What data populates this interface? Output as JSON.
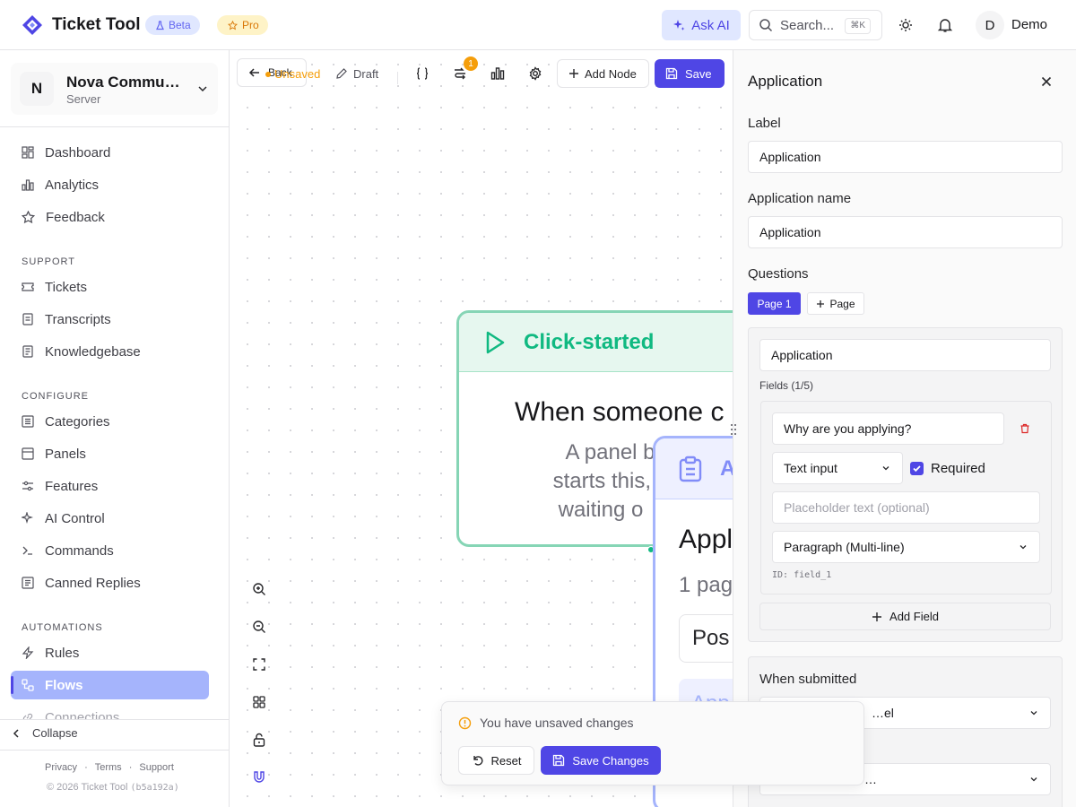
{
  "app": {
    "title": "Ticket Tool",
    "beta": "Beta",
    "pro": "Pro"
  },
  "header": {
    "ask_ai": "Ask AI",
    "search_placeholder": "Search...",
    "search_kbd": "⌘K",
    "avatar_initial": "D",
    "user": "Demo"
  },
  "server": {
    "initial": "N",
    "name": "Nova Community",
    "type": "Server"
  },
  "nav": {
    "top": [
      {
        "label": "Dashboard",
        "icon": "dashboard-icon"
      },
      {
        "label": "Analytics",
        "icon": "bar-chart-icon"
      },
      {
        "label": "Feedback",
        "icon": "star-icon"
      }
    ],
    "support_title": "SUPPORT",
    "support": [
      {
        "label": "Tickets",
        "icon": "ticket-icon"
      },
      {
        "label": "Transcripts",
        "icon": "transcript-icon"
      },
      {
        "label": "Knowledgebase",
        "icon": "book-icon"
      }
    ],
    "configure_title": "CONFIGURE",
    "configure": [
      {
        "label": "Categories",
        "icon": "list-icon"
      },
      {
        "label": "Panels",
        "icon": "panel-icon"
      },
      {
        "label": "Features",
        "icon": "sliders-icon"
      },
      {
        "label": "AI Control",
        "icon": "sparkle-icon"
      },
      {
        "label": "Commands",
        "icon": "terminal-icon"
      },
      {
        "label": "Canned Replies",
        "icon": "reply-icon"
      }
    ],
    "automations_title": "AUTOMATIONS",
    "automations": [
      {
        "label": "Rules",
        "icon": "bolt-icon"
      },
      {
        "label": "Flows",
        "icon": "flow-icon",
        "active": true
      },
      {
        "label": "Connections",
        "icon": "link-icon"
      }
    ]
  },
  "sidebar_footer": {
    "collapse": "Collapse",
    "links": [
      "Privacy",
      "Terms",
      "Support"
    ],
    "copyright": "© 2026 Ticket Tool",
    "build": "(b5a192a)"
  },
  "toolbar": {
    "back": "Back",
    "unsaved": "Unsaved",
    "draft": "Draft",
    "badge": "1",
    "add_node": "Add Node",
    "save": "Save"
  },
  "nodes": {
    "trigger": {
      "header": "Click-started",
      "title": "When someone c",
      "desc_lines": [
        "A panel buttor",
        "starts this, an",
        "waiting o"
      ]
    },
    "application": {
      "header": "A",
      "title": "Appl",
      "subtitle": "1 pag",
      "pos": "Pos",
      "app": "App"
    }
  },
  "unsaved_bar": {
    "message": "You have unsaved changes",
    "reset": "Reset",
    "save_changes": "Save Changes"
  },
  "panel": {
    "title": "Application",
    "label_title": "Label",
    "label_value": "Application",
    "name_title": "Application name",
    "name_value": "Application",
    "questions_title": "Questions",
    "page_chip": "Page 1",
    "page_add": "Page",
    "page_name": "Application",
    "fields_count": "Fields (1/5)",
    "field": {
      "question": "Why are you applying?",
      "type": "Text input",
      "required": "Required",
      "placeholder_ph": "Placeholder text (optional)",
      "style": "Paragraph (Multi-line)",
      "id": "ID: field_1"
    },
    "add_field": "Add Field",
    "when_submitted": "When submitted",
    "submit_select": "…el",
    "second_select": "…"
  },
  "colors": {
    "accent": "#4f46e5",
    "trigger_green": "#10b981",
    "warning": "#f59e0b"
  }
}
